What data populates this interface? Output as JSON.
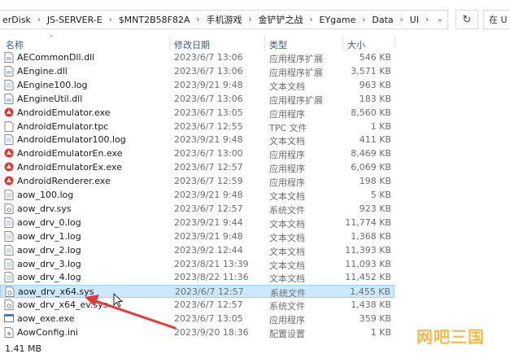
{
  "address_bar": {
    "crumbs": [
      "erDisk",
      "JS-SERVER-E",
      "$MNT2B58F82A",
      "手机游戏",
      "金铲铲之战",
      "EYgame",
      "Data",
      "UI"
    ],
    "search_placeholder": "在 U"
  },
  "columns": {
    "name": "名称",
    "date": "修改日期",
    "type": "类型",
    "size": "大小"
  },
  "files": [
    {
      "name": "AECommonDll.dll",
      "date": "2023/6/7 13:06",
      "type": "应用程序扩展",
      "size": "546 KB",
      "icon": "dll-icon"
    },
    {
      "name": "AEngine.dll",
      "date": "2023/6/7 13:06",
      "type": "应用程序扩展",
      "size": "3,571 KB",
      "icon": "dll-icon"
    },
    {
      "name": "AEngine100.log",
      "date": "2023/9/21 9:48",
      "type": "文本文档",
      "size": "963 KB",
      "icon": "text-file-icon"
    },
    {
      "name": "AEngineUtil.dll",
      "date": "2023/6/7 13:06",
      "type": "应用程序扩展",
      "size": "183 KB",
      "icon": "dll-icon"
    },
    {
      "name": "AndroidEmulator.exe",
      "date": "2023/6/7 13:05",
      "type": "应用程序",
      "size": "8,560 KB",
      "icon": "app-icon"
    },
    {
      "name": "AndroidEmulator.tpc",
      "date": "2023/6/7 12:55",
      "type": "TPC 文件",
      "size": "1 KB",
      "icon": "blank-file-icon"
    },
    {
      "name": "AndroidEmulator100.log",
      "date": "2023/9/21 9:48",
      "type": "文本文档",
      "size": "411 KB",
      "icon": "text-file-icon"
    },
    {
      "name": "AndroidEmulatorEn.exe",
      "date": "2023/6/7 13:00",
      "type": "应用程序",
      "size": "8,469 KB",
      "icon": "app-icon"
    },
    {
      "name": "AndroidEmulatorEx.exe",
      "date": "2023/6/7 12:57",
      "type": "应用程序",
      "size": "6,069 KB",
      "icon": "app-icon"
    },
    {
      "name": "AndroidRenderer.exe",
      "date": "2023/6/7 12:59",
      "type": "应用程序",
      "size": "198 KB",
      "icon": "app-icon"
    },
    {
      "name": "aow_100.log",
      "date": "2023/9/21 9:48",
      "type": "文本文档",
      "size": "5 KB",
      "icon": "text-file-icon"
    },
    {
      "name": "aow_drv.sys",
      "date": "2023/6/7 12:57",
      "type": "系统文件",
      "size": "923 KB",
      "icon": "sys-file-icon"
    },
    {
      "name": "aow_drv_0.log",
      "date": "2023/9/21 9:44",
      "type": "文本文档",
      "size": "11,774 KB",
      "icon": "text-file-icon"
    },
    {
      "name": "aow_drv_1.log",
      "date": "2023/9/21 9:48",
      "type": "文本文档",
      "size": "1,368 KB",
      "icon": "text-file-icon"
    },
    {
      "name": "aow_drv_2.log",
      "date": "2023/9/2 12:44",
      "type": "文本文档",
      "size": "11,393 KB",
      "icon": "text-file-icon"
    },
    {
      "name": "aow_drv_3.log",
      "date": "2023/8/21 13:39",
      "type": "文本文档",
      "size": "11,093 KB",
      "icon": "text-file-icon"
    },
    {
      "name": "aow_drv_4.log",
      "date": "2023/8/22 11:36",
      "type": "文本文档",
      "size": "11,452 KB",
      "icon": "text-file-icon"
    },
    {
      "name": "aow_drv_x64.sys",
      "date": "2023/6/7 12:57",
      "type": "系统文件",
      "size": "1,455 KB",
      "icon": "sys-file-icon",
      "selected": true
    },
    {
      "name": "aow_drv_x64_ev.sys",
      "date": "2023/6/7 12:57",
      "type": "系统文件",
      "size": "1,438 KB",
      "icon": "sys-file-icon"
    },
    {
      "name": "aow_exe.exe",
      "date": "2023/6/7 13:05",
      "type": "应用程序",
      "size": "359 KB",
      "icon": "exe-icon"
    },
    {
      "name": "AowConfig.ini",
      "date": "2023/9/20 18:36",
      "type": "配置设置",
      "size": "1 KB",
      "icon": "ini-file-icon"
    }
  ],
  "status": {
    "selection_size": "1.41 MB"
  },
  "watermark": "网吧三国",
  "colors": {
    "selection_bg": "#cce8ff",
    "selection_border": "#99d1ff",
    "annotation_arrow": "#e53935",
    "header_text": "#3c5a85"
  }
}
